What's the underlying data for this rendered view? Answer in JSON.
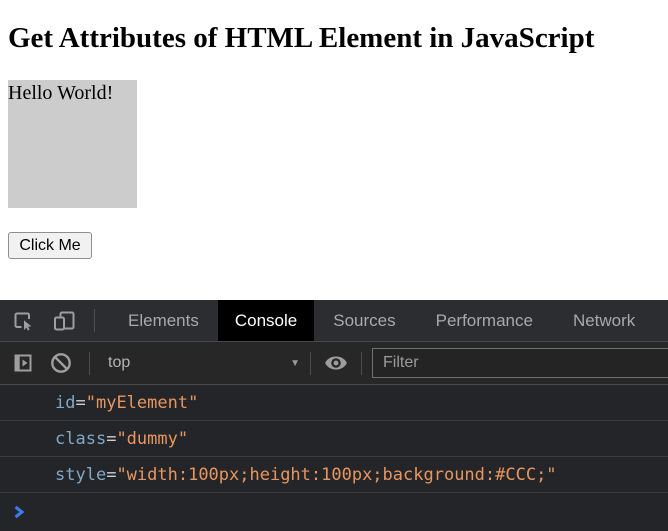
{
  "page": {
    "heading": "Get Attributes of HTML Element in JavaScript",
    "demo_box": {
      "text": "Hello World!",
      "background": "#CCCCCC"
    },
    "button_label": "Click Me"
  },
  "devtools": {
    "tabs": [
      {
        "label": "Elements",
        "active": false
      },
      {
        "label": "Console",
        "active": true
      },
      {
        "label": "Sources",
        "active": false
      },
      {
        "label": "Performance",
        "active": false
      },
      {
        "label": "Network",
        "active": false
      }
    ],
    "toolbar": {
      "context_selector_value": "top",
      "dropdown_arrow": "▼",
      "filter_placeholder": "Filter"
    },
    "console": {
      "messages": [
        {
          "name": "id",
          "eq": "=",
          "value": "\"myElement\""
        },
        {
          "name": "class",
          "eq": "=",
          "value": "\"dummy\""
        },
        {
          "name": "style",
          "eq": "=",
          "value": "\"width:100px;height:100px;background:#CCC;\""
        }
      ]
    },
    "icons": [
      "inspect-element-icon",
      "device-toolbar-icon",
      "console-sidebar-icon",
      "clear-console-icon",
      "eye-icon",
      "dropdown-arrow-icon",
      "prompt-chevron-icon"
    ],
    "colors": {
      "attribute_name": "#7fa8c9",
      "attribute_value": "#e8965f",
      "equals_sign": "#cfcfcf",
      "tabbar_bg": "#2b2d30",
      "toolbar_bg": "#272727",
      "console_bg": "#242528",
      "active_tab_bg": "#000000",
      "active_tab_text": "#ffffff",
      "prompt_chevron": "#3a7bf2"
    }
  }
}
